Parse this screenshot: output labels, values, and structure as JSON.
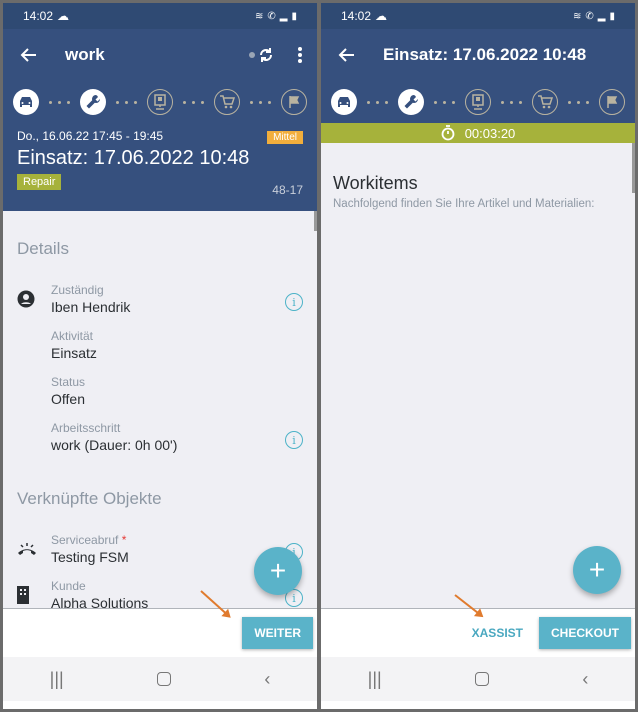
{
  "left": {
    "status_time": "14:02",
    "title": "work",
    "steps": [
      {
        "icon": "car-icon",
        "state": "active"
      },
      {
        "icon": "wrench-icon",
        "state": "active"
      },
      {
        "icon": "signature-pad-icon",
        "state": "inactive"
      },
      {
        "icon": "cart-icon",
        "state": "inactive"
      },
      {
        "icon": "flag-icon",
        "state": "inactive"
      }
    ],
    "header": {
      "date": "Do., 16.06.22 17:45 - 19:45",
      "priority": "Mittel",
      "title": "Einsatz: 17.06.2022 10:48",
      "type": "Repair",
      "number": "48-17"
    },
    "details_title": "Details",
    "fields": [
      {
        "label": "Zuständig",
        "value": "Iben Hendrik"
      },
      {
        "label": "Aktivität",
        "value": "Einsatz"
      },
      {
        "label": "Status",
        "value": "Offen"
      },
      {
        "label": "Arbeitsschritt",
        "value": "work (Dauer: 0h 00')"
      }
    ],
    "linked_title": "Verknüpfte Objekte",
    "linked": [
      {
        "label": "Serviceabruf",
        "required": "*",
        "value": "Testing FSM"
      },
      {
        "label": "Kunde",
        "value": "Alpha Solutions"
      }
    ],
    "fab": "+",
    "primary_button": "WEITER"
  },
  "right": {
    "status_time": "14:02",
    "title": "Einsatz: 17.06.2022 10:48",
    "timer": "00:03:20",
    "workitems_title": "Workitems",
    "workitems_subtitle": "Nachfolgend finden Sie Ihre Artikel und Materialien:",
    "fab": "+",
    "text_button": "XASSIST",
    "primary_button": "CHECKOUT"
  },
  "colors": {
    "primary": "#36507e",
    "accent": "#5ab3c9",
    "green": "#a6b23b",
    "orange": "#f2ae3c"
  }
}
